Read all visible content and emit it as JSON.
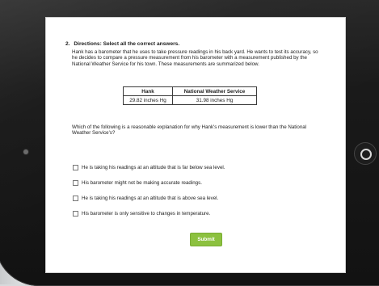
{
  "question": {
    "number": "2.",
    "directions": "Directions: Select all the correct answers.",
    "passage": "Hank has a barometer that he uses to take pressure readings in his back yard. He wants to test its accuracy, so he decides to compare a pressure measurement from his barometer with a measurement published by the National Weather Service for his town. These measurements are summarized below.",
    "table": {
      "headers": [
        "Hank",
        "National Weather Service"
      ],
      "rows": [
        [
          "29.82 inches Hg",
          "31.98 inches Hg"
        ]
      ]
    },
    "prompt": "Which of the following is a reasonable explanation for why Hank's measurement is lower than the National Weather Service's?",
    "choices": [
      {
        "label": "He is taking his readings at an altitude that is far below sea level.",
        "checked": false
      },
      {
        "label": "His barometer might not be making accurate readings.",
        "checked": false
      },
      {
        "label": "He is taking his readings at an altitude that is above sea level.",
        "checked": false
      },
      {
        "label": "His barometer is only sensitive to changes in temperature.",
        "checked": false
      }
    ],
    "submit_label": "Submit"
  },
  "colors": {
    "submit": "#8cc13f",
    "bezel": "#1a1a1a",
    "screen": "#ffffff"
  }
}
